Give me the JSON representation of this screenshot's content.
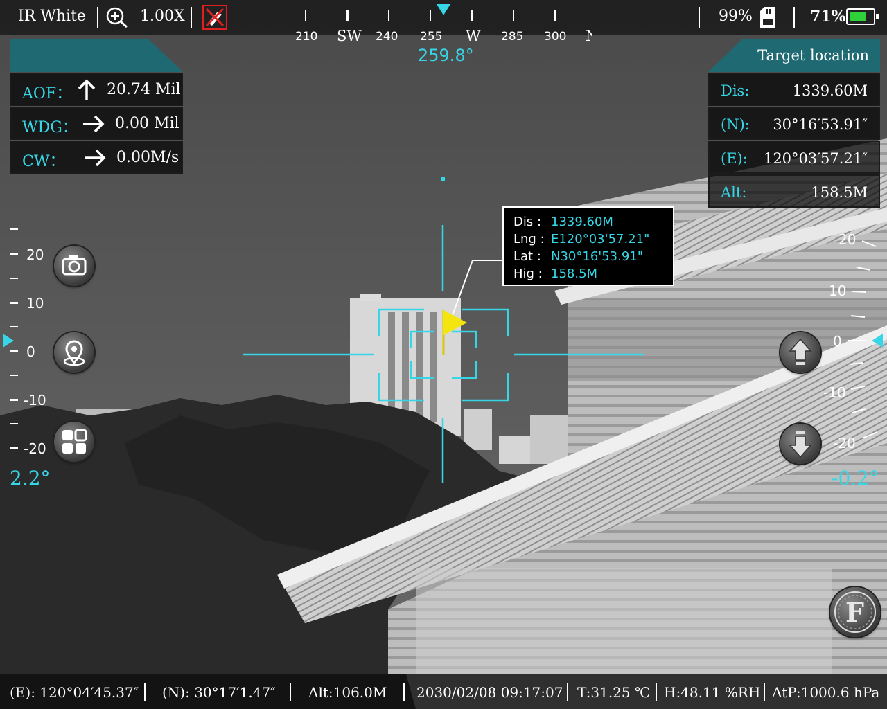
{
  "colors": {
    "accent": "#37d6e6",
    "panel_tab": "#1f6a72",
    "battery_green": "#2fd13a",
    "reticle_flag": "#f5e50f"
  },
  "top_bar": {
    "palette_mode": "IR White",
    "zoom_icon": "zoom-in-icon",
    "zoom_value": "1.00X",
    "laser_off_icon": "laser-disabled-icon",
    "storage_percent": "99%",
    "sd_card_icon": "sd-card-icon",
    "battery_percent": "71%",
    "battery_icon": "battery-icon",
    "battery_level": 0.71
  },
  "compass": {
    "heading": "259.8°",
    "labels": [
      "210",
      "SW",
      "240",
      "255",
      "W",
      "285",
      "300",
      "N"
    ]
  },
  "left_panel": {
    "rows": [
      {
        "label": "AOF：",
        "icon": "arrow-up-icon",
        "value": "20.74 Mil"
      },
      {
        "label": "WDG：",
        "icon": "arrow-right-icon",
        "value": "0.00 Mil"
      },
      {
        "label": "CW：",
        "icon": "arrow-right-icon",
        "value": "0.00M/s"
      }
    ]
  },
  "right_panel": {
    "title": "Target location",
    "rows": [
      {
        "label": "Dis:",
        "value": "1339.60M"
      },
      {
        "label": "(N):",
        "value": "30°16′53.91″"
      },
      {
        "label": "(E):",
        "value": "120°03′57.21″"
      },
      {
        "label": "Alt:",
        "value": "158.5M"
      }
    ]
  },
  "target_popup": {
    "rows": [
      {
        "label": "Dis :",
        "value": "1339.60M"
      },
      {
        "label": "Lng :",
        "value": "E120°03'57.21\""
      },
      {
        "label": "Lat :",
        "value": "N30°16'53.91\""
      },
      {
        "label": "Hig :",
        "value": "158.5M"
      }
    ]
  },
  "left_scale": {
    "labels": [
      "20",
      "10",
      "0",
      "-10",
      "-20"
    ],
    "angle": "2.2°"
  },
  "right_scale": {
    "labels": [
      "20",
      "10",
      "0",
      "-10",
      "-20"
    ],
    "angle": "-0.2°"
  },
  "left_buttons": {
    "camera": "camera-icon",
    "location": "location-pin-icon",
    "apps": "app-grid-icon"
  },
  "right_buttons": {
    "up": "arrow-up-button-icon",
    "down": "arrow-down-button-icon",
    "focus": "F"
  },
  "bottom_bar": {
    "east": "(E): 120°04′45.37″",
    "north": "(N): 30°17′1.47″",
    "alt": "Alt:106.0M",
    "datetime": "2030/02/08 09:17:07",
    "temperature": "T:31.25 ℃",
    "humidity": "H:48.11 %RH",
    "pressure": "AtP:1000.6 hPa"
  }
}
